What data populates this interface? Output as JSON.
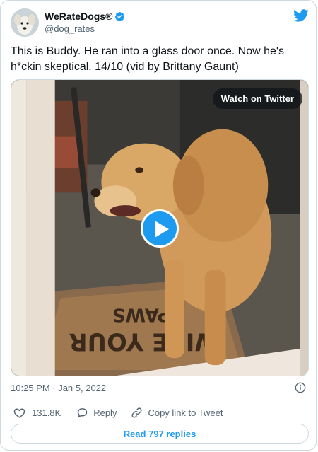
{
  "account": {
    "display_name": "WeRateDogs®",
    "handle": "@dog_rates",
    "verified": true
  },
  "icons": {
    "brand": "twitter-bird-icon",
    "verified": "verified-badge-icon",
    "play": "play-icon",
    "info": "info-icon",
    "like": "heart-icon",
    "reply": "reply-icon",
    "copy": "link-icon"
  },
  "colors": {
    "accent": "#1d9bf0",
    "text": "#0f1419",
    "muted": "#536471",
    "border": "#cfd9de"
  },
  "tweet": {
    "text": "This is Buddy. He ran into a glass door once. Now he's h*ckin skeptical. 14/10 (vid by Brittany Gaunt)",
    "timestamp": "10:25 PM · Jan 5, 2022"
  },
  "media": {
    "type": "video",
    "watch_label": "Watch on Twitter",
    "doormat_text": "WIPE YOUR PAWS"
  },
  "actions": {
    "like_count": "131.8K",
    "reply_label": "Reply",
    "copy_label": "Copy link to Tweet"
  },
  "footer": {
    "read_replies": "Read 797 replies"
  }
}
